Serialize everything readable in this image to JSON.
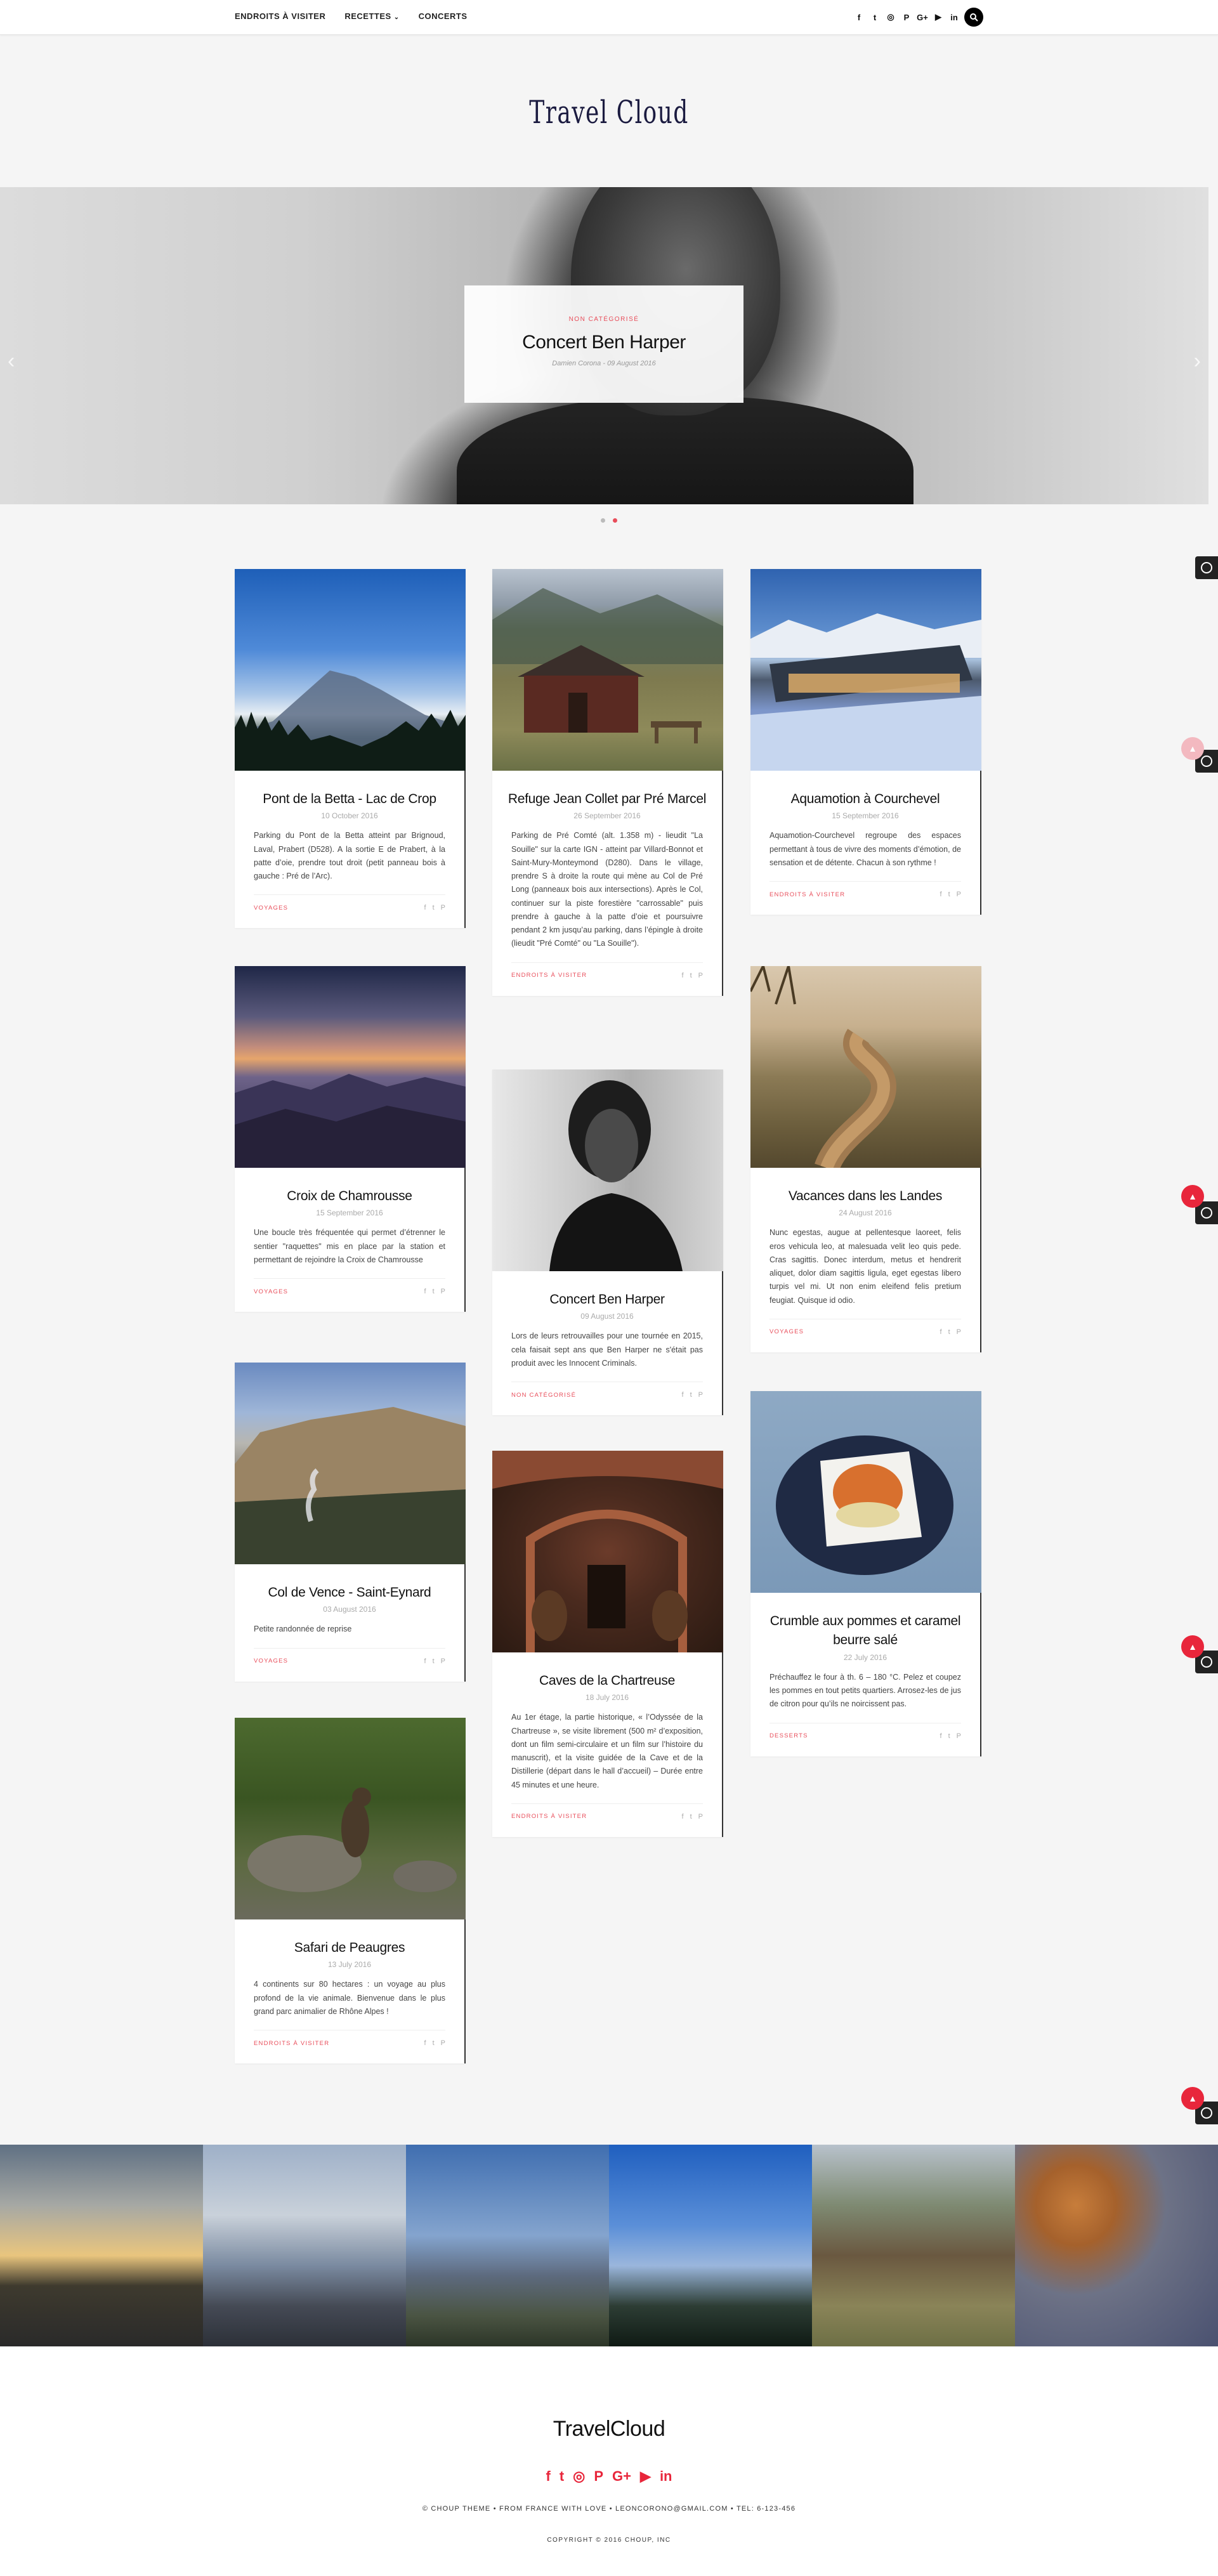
{
  "nav": {
    "items": [
      {
        "label": "ENDROITS À VISITER"
      },
      {
        "label": "RECETTES"
      },
      {
        "label": "CONCERTS"
      }
    ],
    "social": [
      {
        "icon": "facebook-icon",
        "glyph": "f"
      },
      {
        "icon": "twitter-icon",
        "glyph": "t"
      },
      {
        "icon": "instagram-icon",
        "glyph": "◎"
      },
      {
        "icon": "pinterest-icon",
        "glyph": "P"
      },
      {
        "icon": "googleplus-icon",
        "glyph": "G+"
      },
      {
        "icon": "youtube-icon",
        "glyph": "▶"
      },
      {
        "icon": "linkedin-icon",
        "glyph": "in"
      }
    ]
  },
  "logo": "Travel Cloud",
  "hero": {
    "category": "NON CATÉGORISÉ",
    "title": "Concert Ben Harper",
    "meta": "Damien Corona - 09 August 2016"
  },
  "posts": [
    {
      "title": "Pont de la Betta - Lac de Crop",
      "date": "10 October 2016",
      "excerpt": "Parking du Pont de la Betta atteint par Brignoud, Laval, Prabert (D528). A la sortie E de Prabert, à la patte d’oie, prendre tout droit (petit panneau bois à gauche : Pré de l’Arc).",
      "category": "VOYAGES"
    },
    {
      "title": "Refuge Jean Collet par Pré Marcel",
      "date": "26 September 2016",
      "excerpt": "Parking de Pré Comté (alt. 1.358 m) - lieudit \"La Souille\" sur la carte IGN - atteint par Villard-Bonnot et Saint-Mury-Monteymond (D280). Dans le village, prendre S à droite la route qui mène au Col de Pré Long (panneaux bois aux intersections). Après le Col, continuer sur la piste forestière \"carrossable\" puis prendre à gauche à la patte d’oie et poursuivre pendant 2 km jusqu’au parking, dans l’épingle à droite (lieudit \"Pré Comté\" ou \"La Souille\").",
      "category": "ENDROITS À VISITER"
    },
    {
      "title": "Aquamotion à Courchevel",
      "date": "15 September 2016",
      "excerpt": "Aquamotion-Courchevel regroupe des espaces permettant à tous de vivre des moments d’émotion, de sensation et de détente. Chacun à son rythme !",
      "category": "ENDROITS À VISITER"
    },
    {
      "title": "Croix de Chamrousse",
      "date": "15 September 2016",
      "excerpt": "Une boucle très fréquentée qui permet d’étrenner le sentier \"raquettes\" mis en place par la station et permettant de rejoindre la Croix de Chamrousse",
      "category": "VOYAGES"
    },
    {
      "title": "Concert Ben Harper",
      "date": "09 August 2016",
      "excerpt": "Lors de leurs retrouvailles pour une tournée en 2015, cela faisait sept ans que Ben Harper ne s'était pas produit avec les Innocent Criminals.",
      "category": "NON CATÉGORISÉ"
    },
    {
      "title": "Vacances dans les Landes",
      "date": "24 August 2016",
      "excerpt": "Nunc egestas, augue at pellentesque laoreet, felis eros vehicula leo, at malesuada velit leo quis pede. Cras sagittis. Donec interdum, metus et hendrerit aliquet, dolor diam sagittis ligula, eget egestas libero turpis vel mi. Ut non enim eleifend felis pretium feugiat. Quisque id odio.",
      "category": "VOYAGES"
    },
    {
      "title": "Col de Vence - Saint-Eynard",
      "date": "03 August 2016",
      "excerpt": "Petite randonnée de reprise",
      "category": "VOYAGES"
    },
    {
      "title": "Caves de la Chartreuse",
      "date": "18 July 2016",
      "excerpt": "Au 1er étage, la partie historique, « l’Odyssée de la Chartreuse », se visite librement (500 m² d’exposition, dont un film semi-circulaire et un film sur l’histoire du manuscrit), et la visite guidée de la Cave et de la Distillerie (départ dans le hall d’accueil) – Durée entre 45 minutes et une heure.",
      "category": "ENDROITS À VISITER"
    },
    {
      "title": "Crumble aux pommes et caramel beurre salé",
      "date": "22 July 2016",
      "excerpt": "Préchauffez le four à th. 6 – 180 °C. Pelez et coupez les pommes en tout petits quartiers. Arrosez-les de jus de citron pour qu’ils ne noircissent pas.",
      "category": "DESSERTS"
    },
    {
      "title": "Safari de Peaugres",
      "date": "13 July 2016",
      "excerpt": "4 continents sur 80 hectares : un voyage au plus profond de la vie animale. Bienvenue dans le plus grand parc animalier de Rhône Alpes !",
      "category": "ENDROITS À VISITER"
    }
  ],
  "footer": {
    "logo": "TravelCloud",
    "social": [
      "f",
      "t",
      "◎",
      "P",
      "G+",
      "▶",
      "in"
    ],
    "info": "© CHOUP THEME • FROM FRANCE WITH LOVE • LEONCORONO@GMAIL.COM • TEL: 6-123-456",
    "copyright": "COPYRIGHT © 2016 CHOUP, INC"
  },
  "colors": {
    "accent": "#e84d5a",
    "red": "#e8263b",
    "navy": "#1b1b40"
  }
}
